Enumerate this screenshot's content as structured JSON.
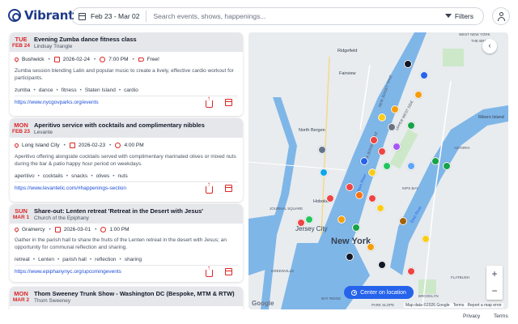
{
  "app": {
    "name": "Vibrant"
  },
  "search": {
    "date_range": "Feb 23 - Mar 02",
    "placeholder": "Search events, shows, happenings...",
    "filters_label": "Filters"
  },
  "events": [
    {
      "dow": "TUE",
      "date": "FEB 24",
      "title": "Evening Zumba dance fitness class",
      "venue": "Lindsay Triangle",
      "neighborhood": "Bushwick",
      "day": "2026-02-24",
      "time": "7:00 PM",
      "price": "Free!",
      "description": "Zumba session blending Latin and popular music to create a lively, effective cardio workout for participants.",
      "tags": [
        "zumba",
        "dance",
        "fitness",
        "Staten Island",
        "cardio"
      ],
      "url": "https://www.nycgovparks.org/events"
    },
    {
      "dow": "MON",
      "date": "FEB 23",
      "title": "Aperitivo service with cocktails and complimentary nibbles",
      "venue": "Levante",
      "neighborhood": "Long Island City",
      "day": "2026-02-23",
      "time": "4:00 PM",
      "price": "",
      "description": "Aperitivo offering alongside cocktails served with complimentary marinated olives or mixed nuts during the bar & patio happy hour period on weekdays.",
      "tags": [
        "aperitivo",
        "cocktails",
        "snacks",
        "olives",
        "nuts"
      ],
      "url": "https://www.levantelic.com/#happenings-section"
    },
    {
      "dow": "SUN",
      "date": "MAR 1",
      "title": "Share-out: Lenten retreat 'Retreat in the Desert with Jesus'",
      "venue": "Church of the Epiphany",
      "neighborhood": "Gramercy",
      "day": "2026-03-01",
      "time": "1:00 PM",
      "price": "",
      "description": "Gather in the parish hall to share the fruits of the Lenten retreat in the desert with Jesus; an opportunity for communal reflection and sharing.",
      "tags": [
        "retreat",
        "Lenten",
        "parish hall",
        "reflection",
        "sharing"
      ],
      "url": "https://www.epiphanynyc.org/upcomingevents"
    },
    {
      "dow": "MON",
      "date": "MAR 2",
      "title": "Thom Sweeney Trunk Show - Washington DC (Bespoke, MTM & RTW)",
      "venue": "Thom Sweeney"
    }
  ],
  "map": {
    "labels": {
      "west_new_york": "WEST NEW YORK",
      "the_bronx": "THE BRONX",
      "ridgefield": "Ridgefield",
      "fairview": "Fairview",
      "north_bergen": "North Bergen",
      "new_jersey_tpke": "NEW JERSEY TPKE",
      "new_jersey_tpke_2": "NEW JERSEY TPKE",
      "rikers": "Rikers Island",
      "hoboken": "Hoboken",
      "journal_square": "JOURNAL SQUARE",
      "jersey_city": "Jersey City",
      "new_york": "New York",
      "greenville": "GREENVILLE",
      "bay_ridge": "BAY RIDGE",
      "brooklyn": "BROOKLYN",
      "park_slope": "PARK SLOPE",
      "astoria": "ASTORIA",
      "hudson_river": "Hudson River",
      "east_river": "East River",
      "kips_bay": "KIPS BAY",
      "upper_west_side": "UPPER WEST SIDE",
      "flatbush": "FLATBUSH"
    },
    "center_label": "Center on location",
    "zoom_in": "+",
    "zoom_out": "−",
    "collapse": "‹",
    "google": "Google",
    "attribution": "Map data ©2026 Google",
    "terms": "Terms",
    "report": "Report a map error",
    "colors": {
      "water": "#7fb6e8",
      "land": "#e8ecef",
      "park": "#cde8c8",
      "accent": "#2563eb"
    }
  },
  "footer": {
    "privacy": "Privacy",
    "terms": "Terms"
  }
}
